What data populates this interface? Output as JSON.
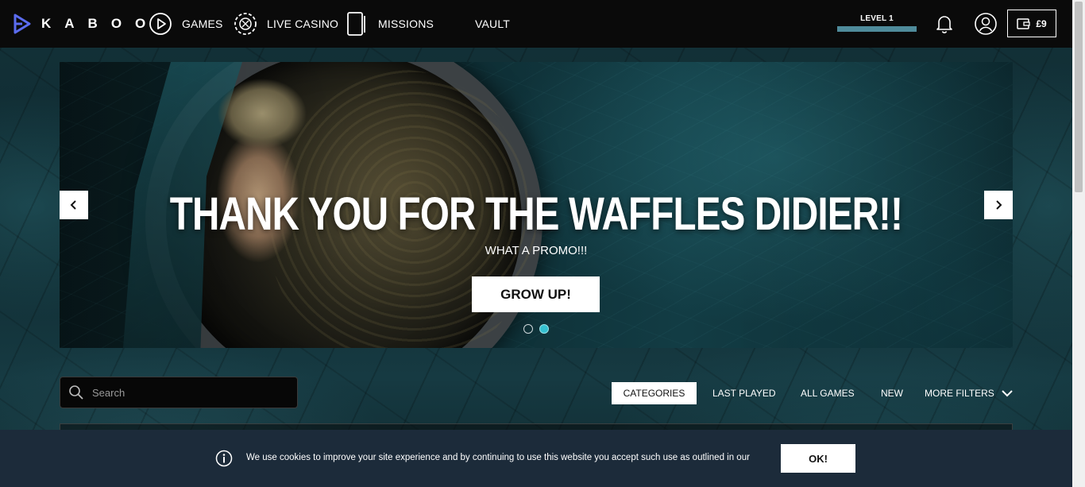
{
  "brand": {
    "name": "KABOO",
    "accent": "#5b6cf0"
  },
  "nav": {
    "items": [
      {
        "label": "GAMES",
        "icon": "play-circle-icon"
      },
      {
        "label": "LIVE CASINO",
        "icon": "poker-chip-icon"
      },
      {
        "label": "MISSIONS",
        "icon": "card-icon"
      },
      {
        "label": "VAULT",
        "icon": "vault-icon"
      }
    ]
  },
  "account": {
    "level_label": "LEVEL 1",
    "level_progress": 1.0,
    "balance": "£9",
    "notification_icon": "bell-icon",
    "profile_icon": "user-icon",
    "wallet_icon": "wallet-icon"
  },
  "hero": {
    "title": "THANK YOU FOR THE WAFFLES DIDIER!!",
    "subtitle": "WHAT A PROMO!!!",
    "cta_label": "GROW UP!",
    "slides_count": 2,
    "active_slide": 2
  },
  "search": {
    "placeholder": "Search"
  },
  "filters": [
    {
      "label": "CATEGORIES",
      "active": true
    },
    {
      "label": "LAST PLAYED",
      "active": false
    },
    {
      "label": "ALL GAMES",
      "active": false
    },
    {
      "label": "NEW",
      "active": false
    },
    {
      "label": "MORE FILTERS",
      "active": false
    }
  ],
  "cookie": {
    "text": "We use cookies to improve your site experience and by continuing to use this website you accept such use as outlined in our",
    "ok_label": "OK!"
  }
}
